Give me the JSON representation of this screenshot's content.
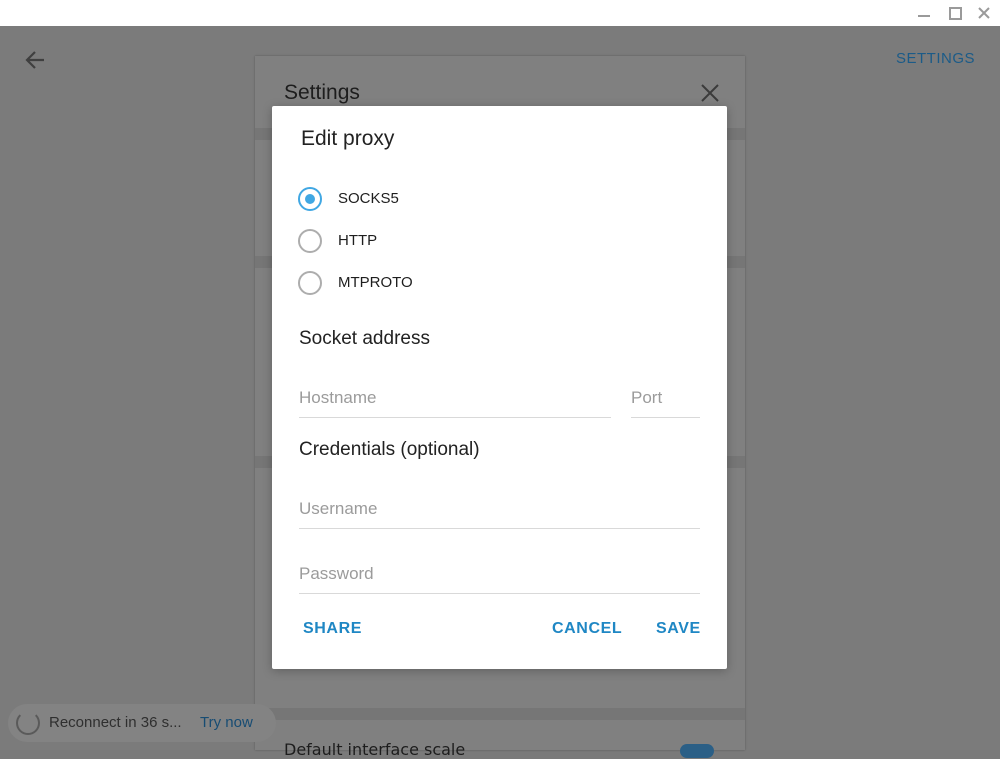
{
  "window": {
    "minimize_icon": "minimize-icon",
    "maximize_icon": "maximize-icon",
    "close_icon": "close-icon"
  },
  "header": {
    "settings_link": "SETTINGS"
  },
  "settings_panel": {
    "title": "Settings",
    "bottom_row_text": "Default interface scale"
  },
  "status": {
    "text": "Reconnect in 36 s...",
    "action": "Try now"
  },
  "dialog": {
    "title": "Edit proxy",
    "proxy_types": [
      {
        "label": "SOCKS5",
        "checked": true
      },
      {
        "label": "HTTP",
        "checked": false
      },
      {
        "label": "MTPROTO",
        "checked": false
      }
    ],
    "socket_section": "Socket address",
    "hostname": {
      "placeholder": "Hostname",
      "value": ""
    },
    "port": {
      "placeholder": "Port",
      "value": ""
    },
    "credentials_section": "Credentials (optional)",
    "username": {
      "placeholder": "Username",
      "value": ""
    },
    "password": {
      "placeholder": "Password",
      "value": ""
    },
    "buttons": {
      "share": "SHARE",
      "cancel": "CANCEL",
      "save": "SAVE"
    }
  },
  "colors": {
    "accent": "#40a7e3",
    "button_text": "#1f87c4",
    "overlay": "#7b7b7b"
  }
}
